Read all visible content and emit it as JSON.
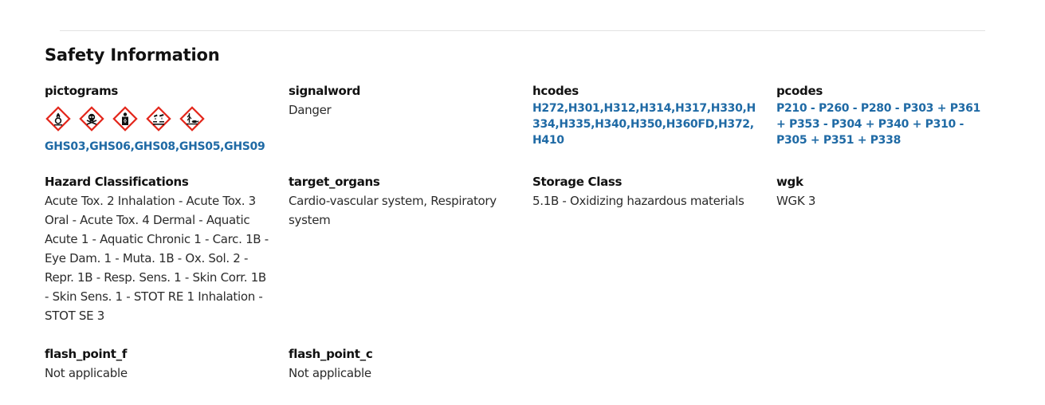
{
  "section": {
    "title": "Safety Information"
  },
  "pictograms": {
    "label": "pictograms",
    "icons": [
      "flame-over-circle-icon",
      "skull-crossbones-icon",
      "health-hazard-icon",
      "corrosion-icon",
      "environment-icon"
    ],
    "codes_text": "GHS03,GHS06,GHS08,GHS05,GHS09"
  },
  "signalword": {
    "label": "signalword",
    "value": "Danger"
  },
  "hcodes": {
    "label": "hcodes",
    "value": "H272,H301,H312,H314,H317,H330,H334,H335,H340,H350,H360FD,H372,H410"
  },
  "pcodes": {
    "label": "pcodes",
    "value": "P210 - P260 - P280 - P303 + P361 + P353 - P304 + P340 + P310 - P305 + P351 + P338"
  },
  "hazard_classifications": {
    "label": "Hazard Classifications",
    "value": "Acute Tox. 2 Inhalation - Acute Tox. 3 Oral - Acute Tox. 4 Dermal - Aquatic Acute 1 - Aquatic Chronic 1 - Carc. 1B - Eye Dam. 1 - Muta. 1B - Ox. Sol. 2 - Repr. 1B - Resp. Sens. 1 - Skin Corr. 1B - Skin Sens. 1 - STOT RE 1 Inhalation - STOT SE 3"
  },
  "target_organs": {
    "label": "target_organs",
    "value": "Cardio-vascular system, Respiratory system"
  },
  "storage_class": {
    "label": "Storage Class",
    "value": "5.1B - Oxidizing hazardous materials"
  },
  "wgk": {
    "label": "wgk",
    "value": "WGK 3"
  },
  "flash_point_f": {
    "label": "flash_point_f",
    "value": "Not applicable"
  },
  "flash_point_c": {
    "label": "flash_point_c",
    "value": "Not applicable"
  },
  "colors": {
    "link": "#1f6aa5",
    "ghs_red": "#e3261b",
    "text": "#2b2b2b",
    "heading": "#111111"
  }
}
